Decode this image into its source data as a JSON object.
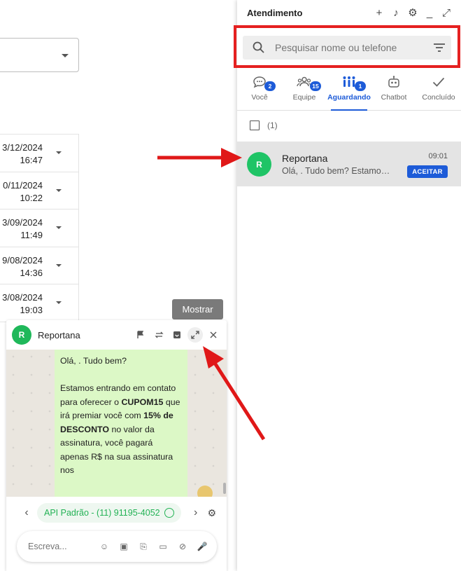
{
  "left_form": {
    "dates": [
      {
        "date": "3/12/2024",
        "time": "16:47"
      },
      {
        "date": "0/11/2024",
        "time": "10:22"
      },
      {
        "date": "3/09/2024",
        "time": "11:49"
      },
      {
        "date": "9/08/2024",
        "time": "14:36"
      },
      {
        "date": "3/08/2024",
        "time": "19:03"
      }
    ],
    "show_button": "Mostrar"
  },
  "chat_widget": {
    "avatar_letter": "R",
    "name": "Reportana",
    "message": {
      "greeting": "Olá, . Tudo bem?",
      "p2_a": "Estamos entrando em contato para oferecer o ",
      "p2_coupon": "CUPOM15",
      "p2_b": " que irá premiar você com ",
      "p2_pct": "15% de DESCONTO",
      "p2_c": " no valor da assinatura, você pagará apenas R$ na sua assinatura nos"
    },
    "channel": "API Padrão - (11) 91195-4052",
    "composer_placeholder": "Escreva..."
  },
  "panel": {
    "title": "Atendimento",
    "search_placeholder": "Pesquisar nome ou telefone",
    "tabs": [
      {
        "label": "Você",
        "badge": "2",
        "icon": "chat-icon"
      },
      {
        "label": "Equipe",
        "badge": "15",
        "icon": "group-icon"
      },
      {
        "label": "Aguardando",
        "badge": "1",
        "icon": "waiting-people-icon"
      },
      {
        "label": "Chatbot",
        "badge": "",
        "icon": "robot-icon"
      },
      {
        "label": "Concluído",
        "badge": "",
        "icon": "check-icon"
      }
    ],
    "active_tab": "Aguardando",
    "selection_count": "(1)",
    "conversation": {
      "avatar_letter": "R",
      "name": "Reportana",
      "preview": "Olá, . Tudo bem? Estamos entrando em contato",
      "time": "09:01",
      "accept_label": "ACEITAR"
    }
  },
  "colors": {
    "accent": "#1d5bd8",
    "highlight": "#e52020",
    "whatsapp_green": "#23b255",
    "bubble": "#dcf8c6"
  }
}
